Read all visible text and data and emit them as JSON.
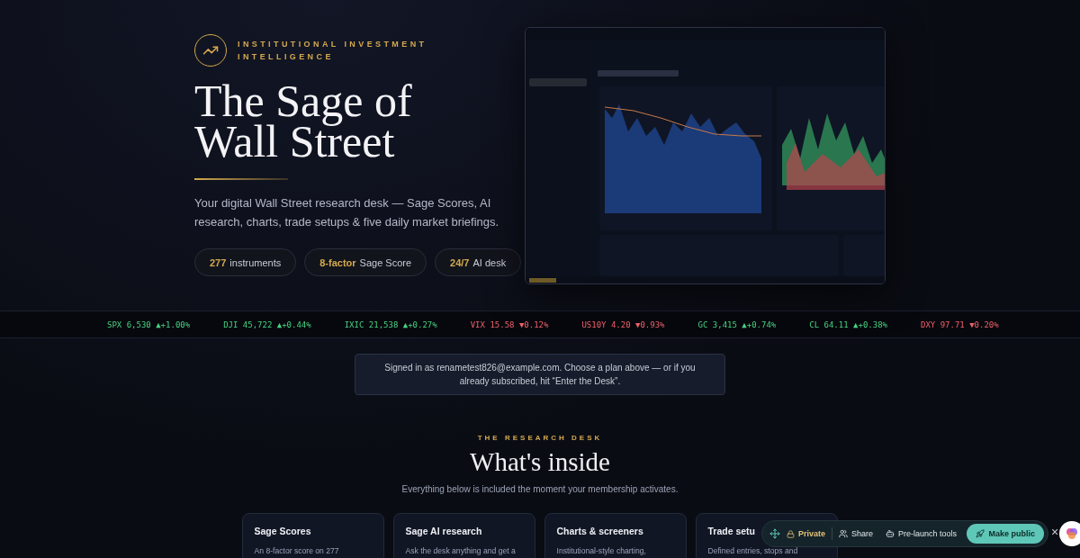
{
  "hero": {
    "eyebrow": [
      "INSTITUTIONAL INVESTMENT",
      "INTELLIGENCE"
    ],
    "title": [
      "The Sage of",
      "Wall Street"
    ],
    "description": "Your digital Wall Street research desk — Sage Scores, AI research, charts, trade setups & five daily market briefings.",
    "pills": [
      {
        "value": "277",
        "label": "instruments"
      },
      {
        "value": "8-factor",
        "label": "Sage Score"
      },
      {
        "value": "24/7",
        "label": "AI desk"
      }
    ]
  },
  "ticker": [
    {
      "symbol": "SPX",
      "price": "6,530",
      "change": "▲+1.00%",
      "up": true
    },
    {
      "symbol": "DJI",
      "price": "45,722",
      "change": "▲+0.44%",
      "up": true
    },
    {
      "symbol": "IXIC",
      "price": "21,538",
      "change": "▲+0.27%",
      "up": true
    },
    {
      "symbol": "VIX",
      "price": "15.58",
      "change": "▼0.12%",
      "up": false
    },
    {
      "symbol": "US10Y",
      "price": "4.20",
      "change": "▼0.93%",
      "up": false
    },
    {
      "symbol": "GC",
      "price": "3,415",
      "change": "▲+0.74%",
      "up": true
    },
    {
      "symbol": "CL",
      "price": "64.11",
      "change": "▲+0.38%",
      "up": true
    },
    {
      "symbol": "DXY",
      "price": "97.71",
      "change": "▼0.20%",
      "up": false
    }
  ],
  "notice": "Signed in as renametest826@example.com. Choose a plan above — or if you already subscribed, hit “Enter the Desk”.",
  "section": {
    "eyebrow": "THE RESEARCH DESK",
    "title": "What's inside",
    "subtitle": "Everything below is included the moment your membership activates."
  },
  "features": [
    {
      "title": "Sage Scores",
      "text": "An 8-factor score on 277"
    },
    {
      "title": "Sage AI research",
      "text": "Ask the desk anything and get a"
    },
    {
      "title": "Charts & screeners",
      "text": "Institutional-style charting,"
    },
    {
      "title": "Trade setu",
      "text": "Defined entries, stops and"
    }
  ],
  "toolbar": {
    "status": "Private",
    "items": [
      {
        "kind": "share",
        "label": "Share"
      },
      {
        "kind": "tools",
        "label": "Pre-launch tools"
      }
    ],
    "primary": "Make public",
    "close": "×"
  }
}
